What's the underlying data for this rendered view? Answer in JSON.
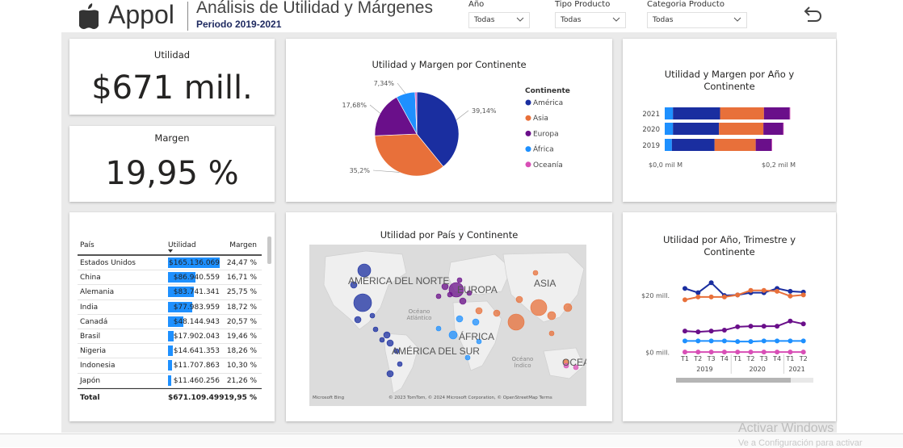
{
  "header": {
    "brand": "Appol",
    "title": "Análisis de Utilidad y Márgenes",
    "subtitle": "Periodo 2019-2021"
  },
  "slicers": [
    {
      "label": "Año",
      "value": "Todas"
    },
    {
      "label": "Tipo Producto",
      "value": "Todas"
    },
    {
      "label": "Categoria Producto",
      "value": "Todas"
    }
  ],
  "kpis": [
    {
      "label": "Utilidad",
      "value": "$671 mill."
    },
    {
      "label": "Margen",
      "value": "19,95 %"
    }
  ],
  "colors": {
    "america": "#1a2ea0",
    "asia": "#e8703a",
    "europa": "#6a0f8a",
    "africa": "#1e90ff",
    "oceania": "#d84fb6",
    "table_bar": "#1e90ff"
  },
  "table": {
    "headers": [
      "País",
      "Utilidad",
      "Margen"
    ],
    "rows": [
      {
        "country": "Estados Unidos",
        "profit": "$165.136.069",
        "share": 1.0,
        "margin": "24,47 %"
      },
      {
        "country": "China",
        "profit": "$86.940.559",
        "share": 0.5265,
        "margin": "16,71 %"
      },
      {
        "country": "Alemania",
        "profit": "$83.741.341",
        "share": 0.5071,
        "margin": "25,75 %"
      },
      {
        "country": "India",
        "profit": "$77.983.959",
        "share": 0.4722,
        "margin": "18,72 %"
      },
      {
        "country": "Canadá",
        "profit": "$48.144.943",
        "share": 0.2915,
        "margin": "20,57 %"
      },
      {
        "country": "Brasil",
        "profit": "$17.902.043",
        "share": 0.1084,
        "margin": "19,46 %"
      },
      {
        "country": "Nigeria",
        "profit": "$14.641.353",
        "share": 0.0887,
        "margin": "18,26 %"
      },
      {
        "country": "Indonesia",
        "profit": "$11.707.863",
        "share": 0.0709,
        "margin": "10,30 %"
      },
      {
        "country": "Japón",
        "profit": "$11.460.256",
        "share": 0.0694,
        "margin": "21,26 %"
      }
    ],
    "total": {
      "label": "Total",
      "profit": "$671.109.499",
      "margin": "19,95 %"
    }
  },
  "map": {
    "title": "Utilidad por País y Continente",
    "labels": [
      "AMÉRICA DEL NORTE",
      "AMÉRICA DEL SUR",
      "EUROPA",
      "ÁFRICA",
      "ASIA",
      "OCEA"
    ],
    "oceans": [
      "Océano Atlántico",
      "Océano Índico"
    ],
    "logo": "Microsoft Bing",
    "credit": "© 2023 TomTom, © 2024 Microsoft Corporation, © OpenStreetMap Terms"
  },
  "chart_data": [
    {
      "type": "pie",
      "title": "Utilidad y Margen por Continente",
      "legend_title": "Continente",
      "legend_position": "right",
      "slices": [
        {
          "name": "América",
          "value": 39.14,
          "label": "39,14%",
          "color": "#1a2ea0"
        },
        {
          "name": "Asia",
          "value": 35.2,
          "label": "35,2%",
          "color": "#e8703a"
        },
        {
          "name": "Europa",
          "value": 17.68,
          "label": "17,68%",
          "color": "#6a0f8a"
        },
        {
          "name": "África",
          "value": 7.34,
          "label": "7,34%",
          "color": "#1e90ff"
        },
        {
          "name": "Oceanía",
          "value": 0.64,
          "label": "",
          "color": "#d84fb6"
        }
      ]
    },
    {
      "type": "bar",
      "orientation": "horizontal",
      "stacked": true,
      "title": "Utilidad y Margen por Año y Continente",
      "categories": [
        "2021",
        "2020",
        "2019"
      ],
      "x_tick_labels": [
        "$0,0 mil M",
        "$0,2 mil M"
      ],
      "xlim": [
        0,
        0.28
      ],
      "series": [
        {
          "name": "África",
          "color": "#1e90ff",
          "values": [
            0.015,
            0.015,
            0.013
          ]
        },
        {
          "name": "América",
          "color": "#1a2ea0",
          "values": [
            0.086,
            0.084,
            0.078
          ]
        },
        {
          "name": "Asia",
          "color": "#e8703a",
          "values": [
            0.08,
            0.081,
            0.075
          ]
        },
        {
          "name": "Europa",
          "color": "#6a0f8a",
          "values": [
            0.047,
            0.036,
            0.029
          ]
        },
        {
          "name": "Oceanía",
          "color": "#d84fb6",
          "values": [
            0.001,
            0.001,
            0.001
          ]
        }
      ]
    },
    {
      "type": "line",
      "title": "Utilidad por Año, Trimestre y Continente",
      "x_quarters": [
        "T1",
        "T2",
        "T3",
        "T4",
        "T1",
        "T2",
        "T3",
        "T4",
        "T1",
        "T2"
      ],
      "x_years": [
        {
          "label": "2019",
          "span": 4
        },
        {
          "label": "2020",
          "span": 4
        },
        {
          "label": "2021",
          "span": 2
        }
      ],
      "y_tick_labels": [
        {
          "value": 20,
          "label": "$20 mill."
        },
        {
          "value": 0,
          "label": "$0 mill."
        }
      ],
      "ylim": [
        -1,
        26
      ],
      "series": [
        {
          "name": "América",
          "color": "#1a2ea0",
          "values": [
            22.5,
            21,
            24.5,
            20,
            20.2,
            21,
            21,
            22.5,
            21.5,
            21.2
          ]
        },
        {
          "name": "Asia",
          "color": "#e8703a",
          "values": [
            18.5,
            19.5,
            19.5,
            19.5,
            20.2,
            21.8,
            21.8,
            21.5,
            19.8,
            20.2
          ]
        },
        {
          "name": "Europa",
          "color": "#6a0f8a",
          "values": [
            7.5,
            7.2,
            7.5,
            7.8,
            9,
            9.2,
            9.2,
            9.2,
            11,
            10
          ]
        },
        {
          "name": "África",
          "color": "#1e90ff",
          "values": [
            4,
            4,
            4,
            4,
            3.8,
            3.8,
            4,
            4,
            4,
            4
          ]
        },
        {
          "name": "Oceanía",
          "color": "#d84fb6",
          "values": [
            0.1,
            0.1,
            0.1,
            0.1,
            0.1,
            0.1,
            0.1,
            0.1,
            0.1,
            0.1
          ]
        }
      ]
    }
  ],
  "watermark": {
    "line1": "Activar Windows",
    "line2": "Ve a Configuración para activar"
  }
}
